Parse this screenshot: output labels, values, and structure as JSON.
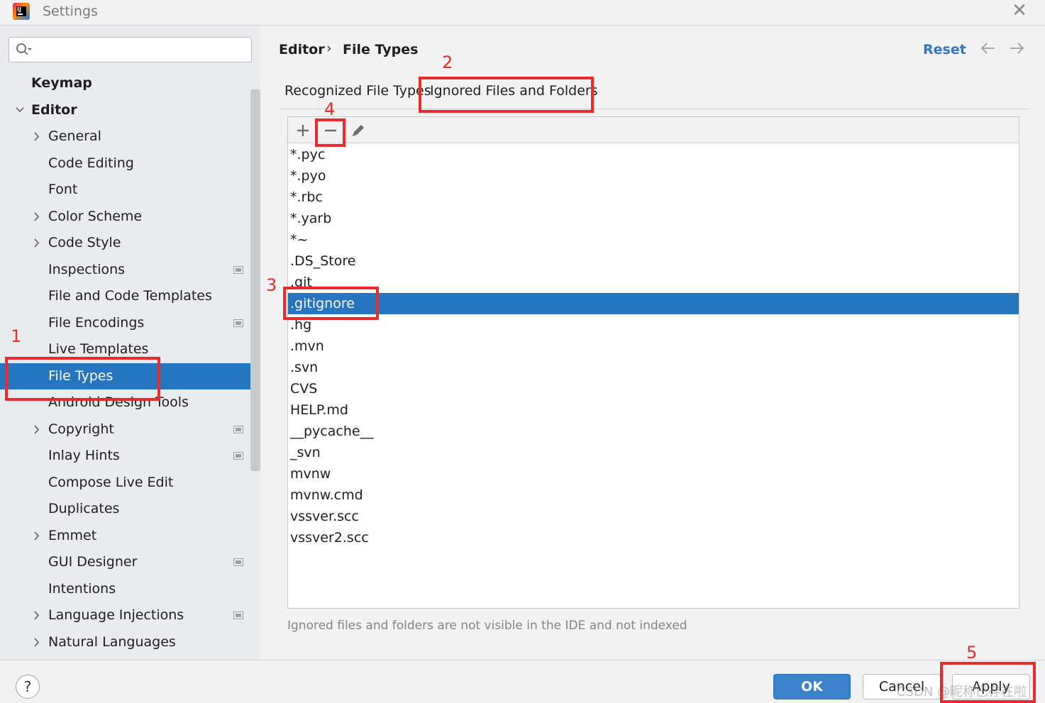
{
  "window": {
    "title": "Settings",
    "close_icon": "close-icon"
  },
  "search": {
    "placeholder": "",
    "value": ""
  },
  "sidebar": {
    "items": [
      {
        "label": "Keymap",
        "bold": true,
        "level": 0,
        "expandable": false,
        "expanded": false
      },
      {
        "label": "Editor",
        "bold": true,
        "level": 0,
        "expandable": true,
        "expanded": true
      },
      {
        "label": "General",
        "level": 1,
        "expandable": true
      },
      {
        "label": "Code Editing",
        "level": 1
      },
      {
        "label": "Font",
        "level": 1
      },
      {
        "label": "Color Scheme",
        "level": 1,
        "expandable": true
      },
      {
        "label": "Code Style",
        "level": 1,
        "expandable": true
      },
      {
        "label": "Inspections",
        "level": 1,
        "project_icon": true
      },
      {
        "label": "File and Code Templates",
        "level": 1
      },
      {
        "label": "File Encodings",
        "level": 1,
        "project_icon": true
      },
      {
        "label": "Live Templates",
        "level": 1
      },
      {
        "label": "File Types",
        "level": 1,
        "selected": true
      },
      {
        "label": "Android Design Tools",
        "level": 1
      },
      {
        "label": "Copyright",
        "level": 1,
        "expandable": true,
        "project_icon": true
      },
      {
        "label": "Inlay Hints",
        "level": 1,
        "project_icon": true
      },
      {
        "label": "Compose Live Edit",
        "level": 1
      },
      {
        "label": "Duplicates",
        "level": 1
      },
      {
        "label": "Emmet",
        "level": 1,
        "expandable": true
      },
      {
        "label": "GUI Designer",
        "level": 1,
        "project_icon": true
      },
      {
        "label": "Intentions",
        "level": 1
      },
      {
        "label": "Language Injections",
        "level": 1,
        "expandable": true,
        "project_icon": true
      },
      {
        "label": "Natural Languages",
        "level": 1,
        "expandable": true
      }
    ]
  },
  "header": {
    "breadcrumb": [
      "Editor",
      "File Types"
    ],
    "separator": "›",
    "reset_label": "Reset",
    "back_icon": "arrow-left-icon",
    "forward_icon": "arrow-right-icon"
  },
  "tabs": [
    {
      "label": "Recognized File Types",
      "active": false
    },
    {
      "label": "Ignored Files and Folders",
      "active": true
    }
  ],
  "toolbar": {
    "add_icon": "plus-icon",
    "remove_icon": "minus-icon",
    "edit_icon": "pencil-icon"
  },
  "ignored_items": [
    "*.pyc",
    "*.pyo",
    "*.rbc",
    "*.yarb",
    "*~",
    ".DS_Store",
    ".git",
    ".gitignore",
    ".hg",
    ".mvn",
    ".svn",
    "CVS",
    "HELP.md",
    "__pycache__",
    "_svn",
    "mvnw",
    "mvnw.cmd",
    "vssver.scc",
    "vssver2.scc"
  ],
  "selected_item": ".gitignore",
  "hint": "Ignored files and folders are not visible in the IDE and not indexed",
  "buttons": {
    "ok": "OK",
    "cancel": "Cancel",
    "apply": "Apply",
    "help": "?"
  },
  "watermark": "CSDN @昵称已存在啦",
  "annotations": [
    "1",
    "2",
    "3",
    "4",
    "5"
  ],
  "colors": {
    "accent": "#2675bf",
    "annotation": "#ea2b2b",
    "link": "#2f76c8"
  }
}
